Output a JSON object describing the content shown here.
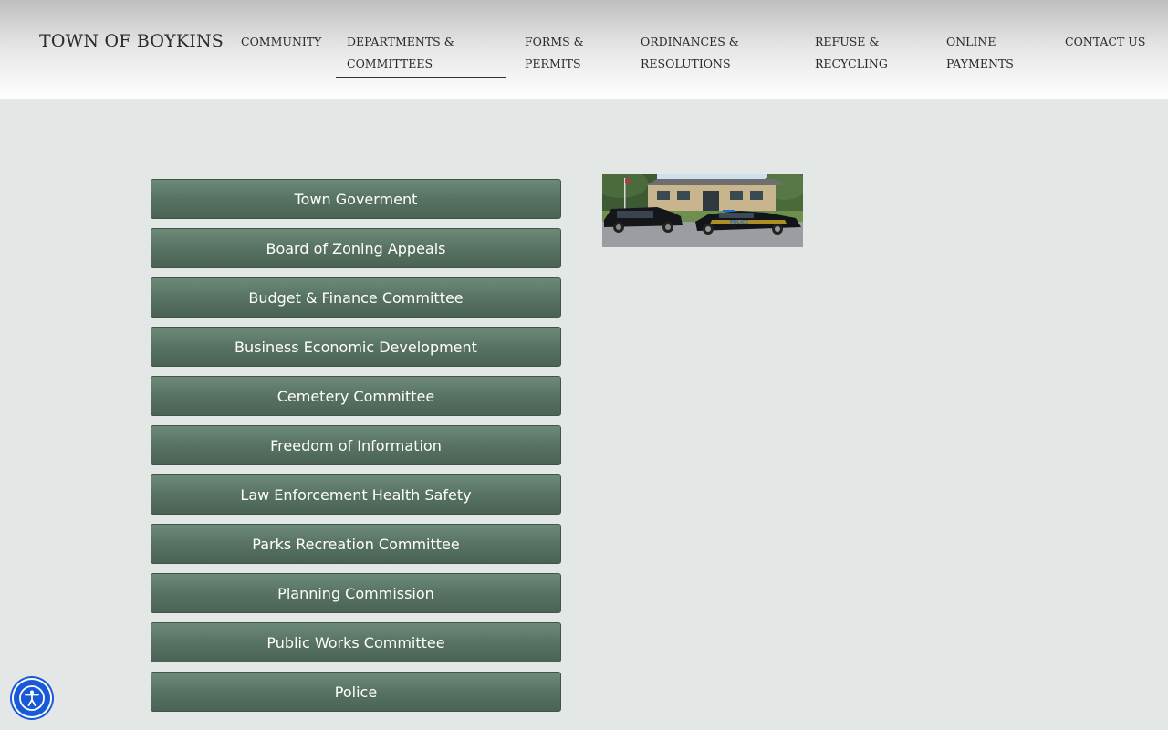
{
  "header": {
    "site_title": "TOWN OF BOYKINS",
    "nav": [
      {
        "label": "COMMUNITY"
      },
      {
        "label": "DEPARTMENTS & COMMITTEES"
      },
      {
        "label": "FORMS & PERMITS"
      },
      {
        "label": "ORDINANCES & RESOLUTIONS"
      },
      {
        "label": "REFUSE & RECYCLING"
      },
      {
        "label": "ONLINE PAYMENTS"
      },
      {
        "label": "CONTACT US"
      }
    ],
    "active_nav": "DEPARTMENTS & COMMITTEES"
  },
  "buttons": [
    {
      "label": "Town Goverment"
    },
    {
      "label": "Board of Zoning Appeals"
    },
    {
      "label": "Budget & Finance Committee"
    },
    {
      "label": "Business Economic Development"
    },
    {
      "label": "Cemetery Committee"
    },
    {
      "label": "Freedom of Information"
    },
    {
      "label": "Law Enforcement Health Safety"
    },
    {
      "label": "Parks Recreation Committee"
    },
    {
      "label": "Planning Commission"
    },
    {
      "label": "Public Works Committee"
    },
    {
      "label": "Police"
    }
  ],
  "photo": {
    "car_decal": "POLICE"
  },
  "colors": {
    "page_bg": "#e3e8e6",
    "button_bg": "#567062",
    "accessibility_blue": "#1759d6"
  },
  "icons": {
    "accessibility": "accessibility-icon"
  }
}
